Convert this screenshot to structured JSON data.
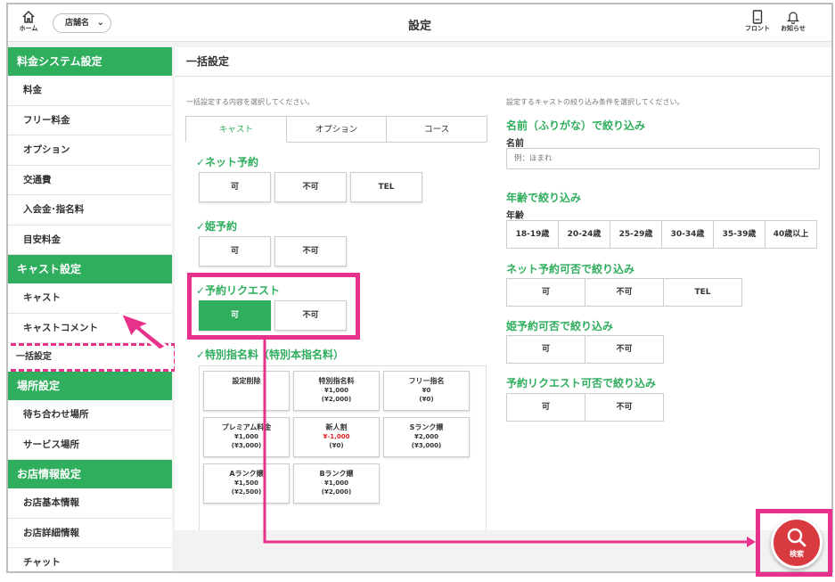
{
  "header": {
    "home_label": "ホーム",
    "store_select": "店舗名",
    "title": "設定",
    "front_label": "フロント",
    "notice_label": "お知らせ"
  },
  "sidebar": {
    "sections": [
      {
        "title": "料金システム設定",
        "items": [
          "料金",
          "フリー料金",
          "オプション",
          "交通費",
          "入会金･指名料",
          "目安料金"
        ]
      },
      {
        "title": "キャスト設定",
        "items": [
          "キャスト",
          "キャストコメント",
          "一括設定"
        ]
      },
      {
        "title": "場所設定",
        "items": [
          "待ち合わせ場所",
          "サービス場所"
        ]
      },
      {
        "title": "お店情報設定",
        "items": [
          "お店基本情報",
          "お店詳細情報",
          "チャット"
        ]
      }
    ],
    "active_item": "一括設定"
  },
  "main": {
    "title": "一括設定",
    "left_hint": "一括設定する内容を選択してください。",
    "tabs": [
      "キャスト",
      "オプション",
      "コース"
    ],
    "active_tab": "キャスト",
    "groups": [
      {
        "heading": "✓ネット予約",
        "options": [
          "可",
          "不可",
          "TEL"
        ]
      },
      {
        "heading": "✓姫予約",
        "options": [
          "可",
          "不可"
        ]
      },
      {
        "heading": "✓予約リクエスト",
        "options": [
          "可",
          "不可"
        ],
        "selected": "可"
      }
    ],
    "special": {
      "heading": "✓特別指名料（特別本指名料）",
      "items": [
        {
          "name": "設定削除",
          "price": "",
          "sub": ""
        },
        {
          "name": "特別指名料",
          "price": "¥1,000",
          "sub": "(¥2,000)"
        },
        {
          "name": "フリー指名",
          "price": "¥0",
          "sub": "(¥0)"
        },
        {
          "name": "プレミアム料金",
          "price": "¥1,000",
          "sub": "(¥3,000)"
        },
        {
          "name": "新人割",
          "price": "¥-1,000",
          "sub": "(¥0)"
        },
        {
          "name": "Sランク嬢",
          "price": "¥2,000",
          "sub": "(¥3,000)"
        },
        {
          "name": "Aランク嬢",
          "price": "¥1,500",
          "sub": "(¥2,500)"
        },
        {
          "name": "Bランク嬢",
          "price": "¥1,000",
          "sub": "(¥2,000)"
        }
      ]
    },
    "filter": {
      "hint": "設定するキャストの絞り込み条件を選択してください。",
      "name_heading": "名前（ふりがな）で絞り込み",
      "name_label": "名前",
      "name_placeholder": "例：ほまれ",
      "age_heading": "年齢で絞り込み",
      "age_label": "年齢",
      "age_options": [
        "18-19歳",
        "20-24歳",
        "25-29歳",
        "30-34歳",
        "35-39歳",
        "40歳以上"
      ],
      "net_heading": "ネット予約可否で絞り込み",
      "net_options": [
        "可",
        "不可",
        "TEL"
      ],
      "hime_heading": "姫予約可否で絞り込み",
      "hime_options": [
        "可",
        "不可"
      ],
      "req_heading": "予約リクエスト可否で絞り込み",
      "req_options": [
        "可",
        "不可"
      ]
    },
    "search_label": "検索"
  },
  "colors": {
    "accent": "#2fae5d",
    "highlight": "#e8318b",
    "search": "#d93a3f"
  }
}
